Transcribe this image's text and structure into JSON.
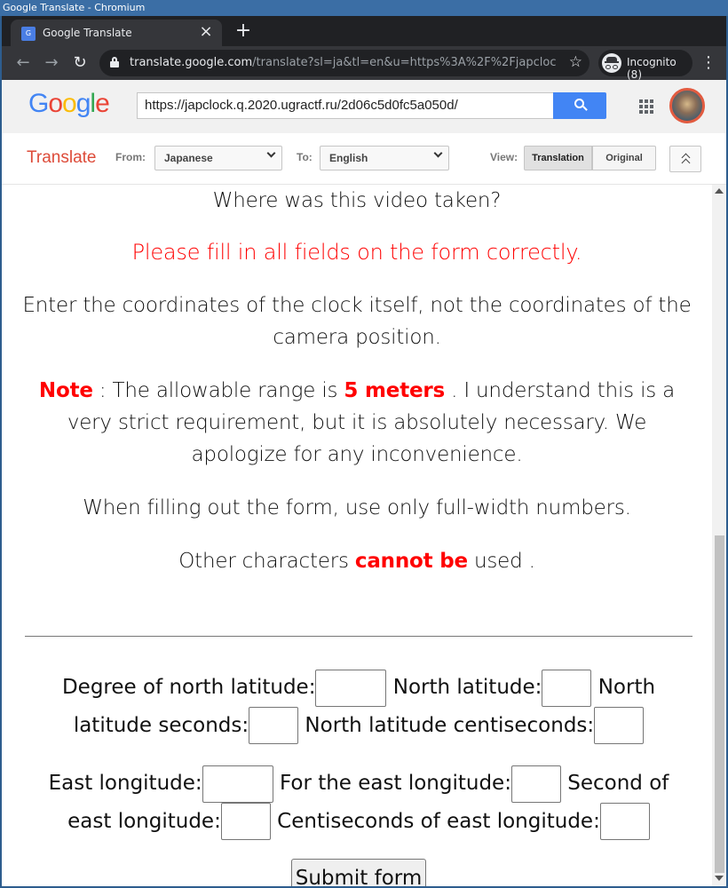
{
  "os": {
    "window_title": "Google Translate - Chromium"
  },
  "browser": {
    "tab_title": "Google Translate",
    "tab_close": "×",
    "new_tab": "+",
    "url_host": "translate.google.com",
    "url_rest": "/translate?sl=ja&tl=en&u=https%3A%2F%2Fjapclock.q....",
    "incognito_label": "Incognito (8)"
  },
  "google_header": {
    "logo_letters": [
      "G",
      "o",
      "o",
      "g",
      "l",
      "e"
    ],
    "url_input_value": "https://japclock.q.2020.ugractf.ru/2d06c5d0fc5a050d/"
  },
  "translate_bar": {
    "title": "Translate",
    "from_label": "From:",
    "from_value": "Japanese",
    "to_label": "To:",
    "to_value": "English",
    "view_label": "View:",
    "view_translation": "Translation",
    "view_original": "Original"
  },
  "page": {
    "question": "Where was this video taken?",
    "fill_notice": "Please fill in all fields on the form correctly.",
    "coords_instruction": "Enter the coordinates of the clock itself, not the coordinates of the camera position.",
    "note_label": "Note",
    "note_part1": " : The allowable range is ",
    "note_range": "5 meters",
    "note_part2": " . I understand this is a very strict requirement, but it is absolutely necessary. We apologize for any inconvenience.",
    "fullwidth_instruction": "When filling out the form, use only full-width numbers.",
    "other_chars_part1": "Other characters ",
    "other_chars_red": "cannot be",
    "other_chars_part2": " used ."
  },
  "form": {
    "lat_degree_label": "Degree of north latitude:",
    "lat_minute_label": " North latitude:",
    "lat_second_label": " North latitude seconds:",
    "lat_centisecond_label": " North latitude centiseconds:",
    "lon_degree_label": "East longitude:",
    "lon_minute_label": " For the east longitude:",
    "lon_second_label": " Second of east longitude:",
    "lon_centisecond_label": " Centiseconds of east longitude:",
    "submit_label": "Submit form"
  }
}
